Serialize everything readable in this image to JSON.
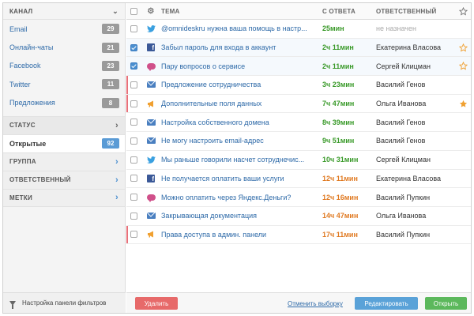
{
  "sidebar": {
    "channel_header": "КАНАЛ",
    "channels": [
      {
        "label": "Email",
        "count": "29"
      },
      {
        "label": "Онлайн-чаты",
        "count": "21"
      },
      {
        "label": "Facebook",
        "count": "23"
      },
      {
        "label": "Twitter",
        "count": "11"
      },
      {
        "label": "Предложения",
        "count": "8"
      }
    ],
    "status_header": "СТАТУС",
    "open_label": "Открытые",
    "open_count": "92",
    "sections": [
      "ГРУППА",
      "ОТВЕТСТВЕННЫЙ",
      "МЕТКИ"
    ],
    "footer_label": "Настройка панели фильтров"
  },
  "table": {
    "headers": {
      "subject": "ТЕМА",
      "since_reply": "С ОТВЕТА",
      "responsible": "ОТВЕТСТВЕННЫЙ"
    },
    "rows": [
      {
        "channel": "twitter-icon",
        "subject": "@omnideskru нужна ваша помощь в настр...",
        "time": "25мин",
        "time_color": "green",
        "responsible": "не назначен",
        "checked": false,
        "star": "none",
        "flag": false
      },
      {
        "channel": "facebook-icon",
        "subject": "Забыл пароль для входа в аккаунт",
        "time": "2ч 11мин",
        "time_color": "green",
        "responsible": "Екатерина Власова",
        "checked": true,
        "star": "outline",
        "flag": false
      },
      {
        "channel": "chat-icon",
        "subject": "Пару вопросов о сервисе",
        "time": "2ч 11мин",
        "time_color": "green",
        "responsible": "Сергей Клицман",
        "checked": true,
        "star": "outline",
        "flag": false
      },
      {
        "channel": "mail-icon",
        "subject": "Предложение сотрудничества",
        "time": "3ч 23мин",
        "time_color": "green",
        "responsible": "Василий Генов",
        "checked": false,
        "star": "none",
        "flag": true
      },
      {
        "channel": "megaphone-icon",
        "subject": "Дополнительные поля данных",
        "time": "7ч 47мин",
        "time_color": "green",
        "responsible": "Ольга Иванова",
        "checked": false,
        "star": "filled",
        "flag": true
      },
      {
        "channel": "mail-icon",
        "subject": "Настройка собственного домена",
        "time": "8ч 39мин",
        "time_color": "green",
        "responsible": "Василий Генов",
        "checked": false,
        "star": "none",
        "flag": false
      },
      {
        "channel": "mail-icon",
        "subject": "Не могу настроить email-адрес",
        "time": "9ч 51мин",
        "time_color": "green",
        "responsible": "Василий Генов",
        "checked": false,
        "star": "none",
        "flag": false
      },
      {
        "channel": "twitter-icon",
        "subject": "Мы раньше говорили насчет сотруднечис...",
        "time": "10ч 31мин",
        "time_color": "green",
        "responsible": "Сергей Клицман",
        "checked": false,
        "star": "none",
        "flag": false
      },
      {
        "channel": "facebook-icon",
        "subject": "Не получается оплатить ваши услуги",
        "time": "12ч 11мин",
        "time_color": "orange",
        "responsible": "Екатерина Власова",
        "checked": false,
        "star": "none",
        "flag": false
      },
      {
        "channel": "chat-icon",
        "subject": "Можно оплатить через Яндекс.Деньги?",
        "time": "12ч 16мин",
        "time_color": "orange",
        "responsible": "Василий Пупкин",
        "checked": false,
        "star": "none",
        "flag": false
      },
      {
        "channel": "mail-icon",
        "subject": "Закрывающая документация",
        "time": "14ч 47мин",
        "time_color": "orange",
        "responsible": "Ольга Иванова",
        "checked": false,
        "star": "none",
        "flag": false
      },
      {
        "channel": "megaphone-icon",
        "subject": "Права доступа в админ. панели",
        "time": "17ч 11мин",
        "time_color": "orange",
        "responsible": "Василий Пупкин",
        "checked": false,
        "star": "none",
        "flag": true
      }
    ]
  },
  "toolbar": {
    "delete_label": "Удалить",
    "clear_label": "Отменить выборку",
    "edit_label": "Редактировать",
    "open_label": "Открыть"
  },
  "colors": {
    "accent": "#4a8fd0",
    "green": "#3a9a2a",
    "orange": "#e07a22",
    "danger": "#e76a6a",
    "success": "#5cb85c"
  }
}
